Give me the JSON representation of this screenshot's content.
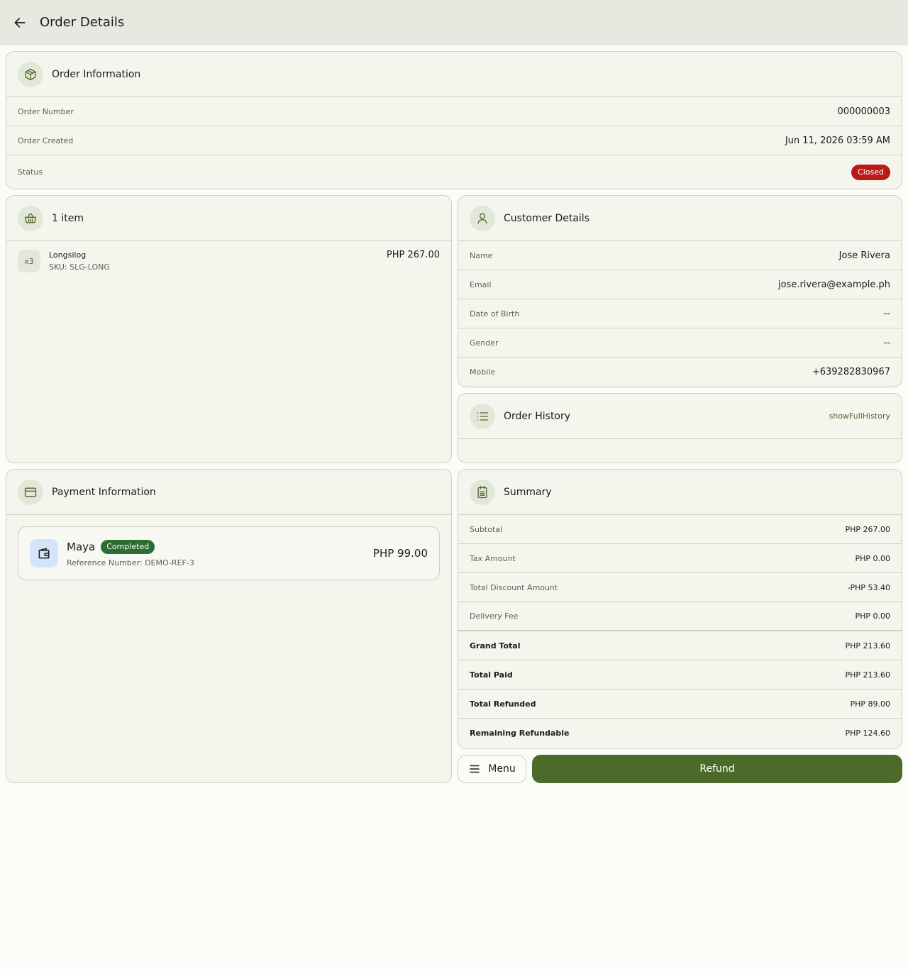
{
  "header": {
    "title": "Order Details",
    "back_icon": "arrow-left-icon"
  },
  "order_info": {
    "title": "Order Information",
    "icon": "package-icon",
    "order_number_label": "Order Number",
    "order_number": "000000003",
    "created_label": "Order Created",
    "created": "Jun 11, 2026 03:59 AM",
    "status_label": "Status",
    "status": "Closed",
    "status_color": "#ba1a1a"
  },
  "items": {
    "title": "1 item",
    "icon": "basket-icon",
    "list": [
      {
        "qty": "x3",
        "name": "Longsilog",
        "sku": "SKU: SLG-LONG",
        "price": "PHP 267.00"
      }
    ]
  },
  "customer": {
    "title": "Customer Details",
    "icon": "user-icon",
    "name_label": "Name",
    "name": "Jose Rivera",
    "email_label": "Email",
    "email": "jose.rivera@example.ph",
    "dob_label": "Date of Birth",
    "dob": "--",
    "gender_label": "Gender",
    "gender": "--",
    "mobile_label": "Mobile",
    "mobile": "+639282830967"
  },
  "history": {
    "title": "Order History",
    "icon": "list-icon",
    "link": "showFullHistory"
  },
  "payment": {
    "title": "Payment Information",
    "icon": "credit-card-icon",
    "method": "Maya",
    "status": "Completed",
    "status_color": "#2d6d31",
    "reference": "Reference Number: DEMO-REF-3",
    "amount": "PHP 99.00"
  },
  "summary": {
    "title": "Summary",
    "icon": "receipt-icon",
    "subtotal_label": "Subtotal",
    "subtotal": "PHP 267.00",
    "tax_label": "Tax Amount",
    "tax": "PHP 0.00",
    "discount_label": "Total Discount Amount",
    "discount": "-PHP 53.40",
    "delivery_label": "Delivery Fee",
    "delivery": "PHP 0.00",
    "grand_total_label": "Grand Total",
    "grand_total": "PHP 213.60",
    "total_paid_label": "Total Paid",
    "total_paid": "PHP 213.60",
    "total_refunded_label": "Total Refunded",
    "total_refunded": "PHP 89.00",
    "remaining_label": "Remaining Refundable",
    "remaining": "PHP 124.60"
  },
  "actions": {
    "menu_label": "Menu",
    "refund_label": "Refund",
    "accent": "#4c6a2a"
  }
}
